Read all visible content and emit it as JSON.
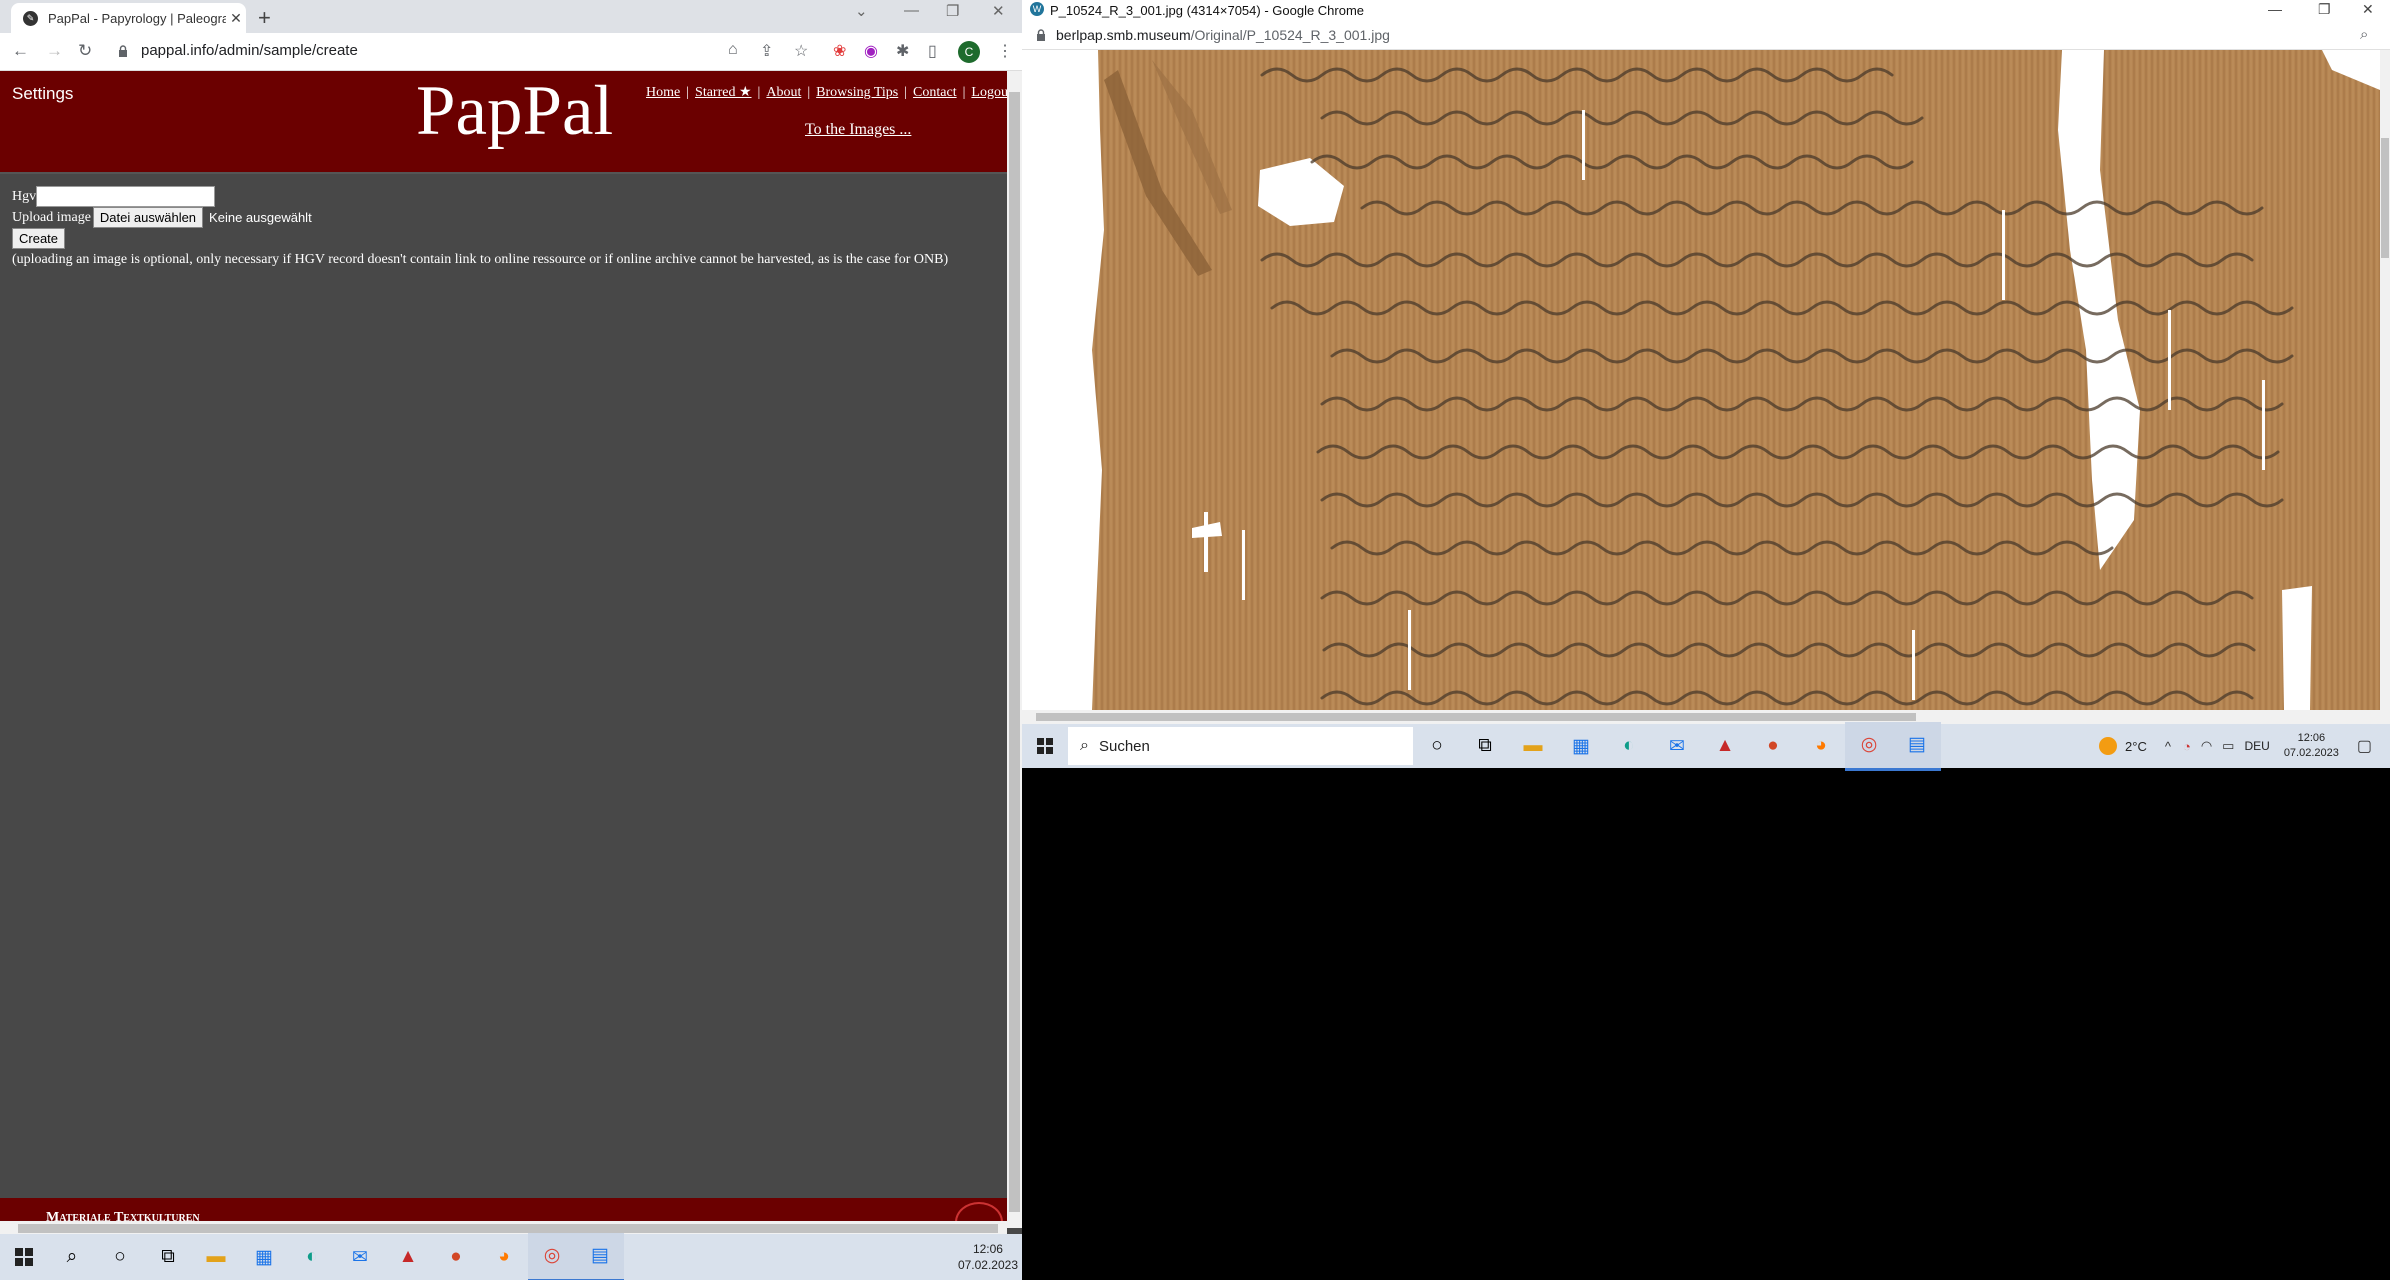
{
  "left_window": {
    "tab_title": "PapPal - Papyrology | Paleograph",
    "url": "pappal.info/admin/sample/create",
    "avatar_letter": "C",
    "header": {
      "settings": "Settings",
      "logo": "PapPal",
      "nav": [
        "Home",
        "Starred ★",
        "About",
        "Browsing Tips",
        "Contact",
        "Logou"
      ],
      "to_images": "To the Images ..."
    },
    "form": {
      "hgv_label": "Hgv",
      "hgv_value": "",
      "upload_label": "Upload image",
      "file_button": "Datei auswählen",
      "no_file": "Keine ausgewählt",
      "create_button": "Create",
      "note": "(uploading an image is optional, only necessary if HGV record doesn't contain link to online ressource or if online archive cannot be harvested, as is the case for ONB)"
    },
    "footer_text": "Materiale Textkulturen"
  },
  "right_window": {
    "title": "P_10524_R_3_001.jpg (4314×7054) - Google Chrome",
    "url_host": "berlpap.smb.museum",
    "url_path": "/Original/P_10524_R_3_001.jpg"
  },
  "taskbar_main": {
    "time": "12:06",
    "date": "07.02.2023"
  },
  "taskbar_right": {
    "search_placeholder": "Suchen",
    "temperature": "2°C",
    "language": "DEU",
    "time": "12:06",
    "date": "07.02.2023"
  },
  "colors": {
    "header_red": "#6b0000",
    "page_bg": "#484848",
    "papyrus": "#b58552"
  }
}
